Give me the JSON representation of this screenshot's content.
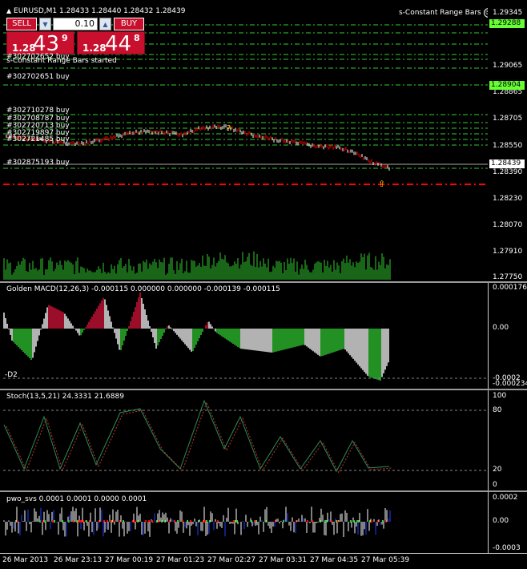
{
  "header": {
    "symbol_line": "EURUSD,M1  1.28433 1.28440 1.28432 1.28439",
    "expert": "s-Constant Range Bars"
  },
  "one_click": {
    "sell_label": "SELL",
    "buy_label": "BUY",
    "lot_value": "0.10",
    "sell_price_small": "1.28",
    "sell_price_big": "43",
    "sell_price_sup": "9",
    "buy_price_small": "1.28",
    "buy_price_big": "44",
    "buy_price_sup": "8"
  },
  "main": {
    "messages": [
      "s-Constant Range Bars started"
    ],
    "trades": [
      "#302702651 buy",
      "#302710278 buy",
      "#302708787 buy",
      "#302720713 buy",
      "#302719897 buy",
      "#302721485 buy",
      "#302875193 buy",
      "#302702652 buy"
    ],
    "price_ticks": [
      "1.29345",
      "1.29065",
      "1.28865",
      "1.28705",
      "1.28550",
      "1.28390",
      "1.28230",
      "1.28070",
      "1.27910",
      "1.27750"
    ],
    "price_tags": {
      "top": "1.29288",
      "mid": "1.28904",
      "current": "1.28439"
    },
    "colors": {
      "bull": "#ffffff",
      "bear": "#ff0000",
      "volume": "#32cd32",
      "level": "#32cd32",
      "stop": "#ff0000",
      "tag_green": "#66ff33"
    }
  },
  "macd": {
    "label": "Golden MACD(12,26,3) -0.000115 0.000000 0.000000 -0.000139 -0.000115",
    "side_label": "-D2",
    "ticks": [
      "0.000176",
      "0.00",
      "-0.0002",
      "-0.000234"
    ]
  },
  "stoch": {
    "label": "Stoch(13,5,21) 24.3331 21.6889",
    "ticks": [
      "100",
      "80",
      "20",
      "0"
    ]
  },
  "pwo": {
    "label": "pwo_svs 0.0001 0.0001 0.0000 0.0001",
    "ticks": [
      "0.0002",
      "0.00",
      "-0.0003"
    ]
  },
  "time_axis": [
    "26 Mar 2013",
    "26 Mar 23:13",
    "27 Mar 00:19",
    "27 Mar 01:23",
    "27 Mar 02:27",
    "27 Mar 03:31",
    "27 Mar 04:35",
    "27 Mar 05:39"
  ]
}
